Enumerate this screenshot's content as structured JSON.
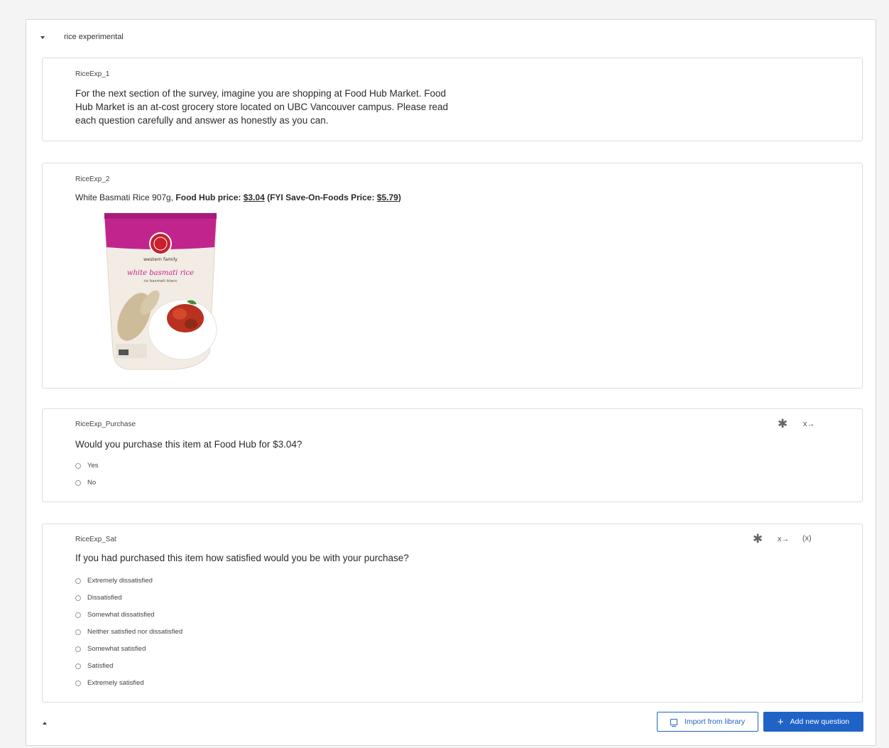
{
  "block": {
    "title": "rice experimental"
  },
  "questions": [
    {
      "id": "RiceExp_1",
      "text_lines": [
        "For the next section of the survey, imagine you are shopping at Food Hub Market. Food",
        "Hub Market is an at-cost grocery store located on UBC Vancouver campus. Please read",
        "each question carefully and answer as honestly as you can."
      ]
    },
    {
      "id": "RiceExp_2",
      "text_prefix": "White Basmati Rice 907g, ",
      "text_bold1": "Food Hub price: ",
      "text_price1": "$3.04",
      "text_bold2": " (FYI Save-On-Foods Price: ",
      "text_price2": "$5.79",
      "text_bold3": ")",
      "image": {
        "brand": "western family",
        "product": "white basmati rice",
        "subtitle": "riz basmati blanc",
        "brand_color": "#c2248e"
      }
    },
    {
      "id": "RiceExp_Purchase",
      "text": "Would you purchase this item at Food Hub for $3.04?",
      "choices": [
        "Yes",
        "No"
      ],
      "tools": [
        "star-icon",
        "x-arrow-icon"
      ],
      "tool_x_label": "x→"
    },
    {
      "id": "RiceExp_Sat",
      "text": "If you had purchased this item how satisfied would you be with your purchase?",
      "choices": [
        "Extremely dissatisfied",
        "Dissatisfied",
        "Somewhat dissatisfied",
        "Neither satisfied nor dissatisfied",
        "Somewhat satisfied",
        "Satisfied",
        "Extremely satisfied"
      ],
      "tools": [
        "star-icon",
        "x-arrow-icon",
        "piped-text-icon"
      ],
      "tool_x_label": "x→",
      "tool_piped_label": "(x)"
    }
  ],
  "footer": {
    "import_label": "Import from library",
    "add_label": "Add new question",
    "primary_color": "#1f63c6"
  }
}
